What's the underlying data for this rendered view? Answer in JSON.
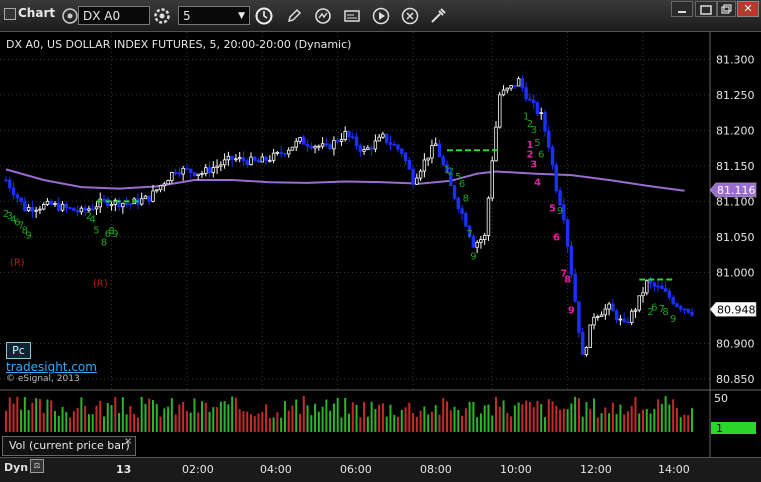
{
  "toolbar": {
    "title": "Chart",
    "symbol": "DX A0",
    "interval": "5",
    "icons": [
      "gear-icon",
      "clock-icon",
      "pencil-icon",
      "cycle-icon",
      "gallery-icon",
      "play-icon",
      "settings-icon",
      "tools-icon"
    ]
  },
  "chart_data": {
    "type": "candlestick",
    "title": "DX A0, US DOLLAR INDEX FUTURES, 5, 20:00-20:00 (Dynamic)",
    "y_ticks": [
      "81.300",
      "81.250",
      "81.200",
      "81.150",
      "81.100",
      "81.050",
      "81.000",
      "80.900",
      "80.850"
    ],
    "y_range": [
      80.84,
      81.33
    ],
    "x_ticks": [
      "13",
      "02:00",
      "04:00",
      "06:00",
      "08:00",
      "10:00",
      "12:00",
      "14:00"
    ],
    "last_price": "80.948",
    "ma_value": "81.116",
    "moving_average": [
      {
        "bar": 0,
        "v": 81.145
      },
      {
        "bar": 10,
        "v": 81.13
      },
      {
        "bar": 20,
        "v": 81.12
      },
      {
        "bar": 30,
        "v": 81.118
      },
      {
        "bar": 40,
        "v": 81.121
      },
      {
        "bar": 50,
        "v": 81.13
      },
      {
        "bar": 60,
        "v": 81.13
      },
      {
        "bar": 70,
        "v": 81.127
      },
      {
        "bar": 80,
        "v": 81.126
      },
      {
        "bar": 90,
        "v": 81.128
      },
      {
        "bar": 100,
        "v": 81.127
      },
      {
        "bar": 110,
        "v": 81.125
      },
      {
        "bar": 118,
        "v": 81.129
      },
      {
        "bar": 125,
        "v": 81.139
      },
      {
        "bar": 130,
        "v": 81.142
      },
      {
        "bar": 140,
        "v": 81.139
      },
      {
        "bar": 150,
        "v": 81.137
      },
      {
        "bar": 160,
        "v": 81.13
      },
      {
        "bar": 170,
        "v": 81.122
      },
      {
        "bar": 180,
        "v": 81.115
      }
    ],
    "price_path": [
      {
        "bar": 0,
        "v": 81.13
      },
      {
        "bar": 5,
        "v": 81.09
      },
      {
        "bar": 12,
        "v": 81.095
      },
      {
        "bar": 20,
        "v": 81.085
      },
      {
        "bar": 26,
        "v": 81.1
      },
      {
        "bar": 33,
        "v": 81.097
      },
      {
        "bar": 38,
        "v": 81.105
      },
      {
        "bar": 45,
        "v": 81.145
      },
      {
        "bar": 52,
        "v": 81.14
      },
      {
        "bar": 60,
        "v": 81.16
      },
      {
        "bar": 67,
        "v": 81.155
      },
      {
        "bar": 72,
        "v": 81.165
      },
      {
        "bar": 78,
        "v": 81.185
      },
      {
        "bar": 85,
        "v": 81.175
      },
      {
        "bar": 90,
        "v": 81.195
      },
      {
        "bar": 95,
        "v": 81.17
      },
      {
        "bar": 100,
        "v": 81.19
      },
      {
        "bar": 105,
        "v": 81.17
      },
      {
        "bar": 108,
        "v": 81.13
      },
      {
        "bar": 112,
        "v": 81.165
      },
      {
        "bar": 114,
        "v": 81.18
      },
      {
        "bar": 118,
        "v": 81.12
      },
      {
        "bar": 122,
        "v": 81.07
      },
      {
        "bar": 124,
        "v": 81.04
      },
      {
        "bar": 127,
        "v": 81.05
      },
      {
        "bar": 129,
        "v": 81.16
      },
      {
        "bar": 131,
        "v": 81.25
      },
      {
        "bar": 134,
        "v": 81.26
      },
      {
        "bar": 136,
        "v": 81.27
      },
      {
        "bar": 139,
        "v": 81.24
      },
      {
        "bar": 142,
        "v": 81.22
      },
      {
        "bar": 144,
        "v": 81.18
      },
      {
        "bar": 146,
        "v": 81.12
      },
      {
        "bar": 148,
        "v": 81.08
      },
      {
        "bar": 150,
        "v": 81.0
      },
      {
        "bar": 152,
        "v": 80.92
      },
      {
        "bar": 153,
        "v": 80.88
      },
      {
        "bar": 156,
        "v": 80.94
      },
      {
        "bar": 160,
        "v": 80.95
      },
      {
        "bar": 164,
        "v": 80.925
      },
      {
        "bar": 167,
        "v": 80.95
      },
      {
        "bar": 170,
        "v": 80.985
      },
      {
        "bar": 174,
        "v": 80.975
      },
      {
        "bar": 178,
        "v": 80.955
      },
      {
        "bar": 182,
        "v": 80.945
      }
    ],
    "bars_count": 183,
    "level_lines": [
      {
        "from": 24,
        "to": 36,
        "v": 81.1,
        "color": "#2fd42f"
      },
      {
        "from": 117,
        "to": 131,
        "v": 81.172,
        "color": "#2fd42f"
      },
      {
        "from": 168,
        "to": 177,
        "v": 80.99,
        "color": "#2fd42f"
      }
    ],
    "markers": [
      {
        "bar": 0,
        "v": 81.078,
        "t": "2",
        "c": "#1fa31f"
      },
      {
        "bar": 1,
        "v": 81.075,
        "t": "3",
        "c": "#1fa31f"
      },
      {
        "bar": 2,
        "v": 81.07,
        "t": "4",
        "c": "#1fa31f"
      },
      {
        "bar": 3,
        "v": 81.066,
        "t": "6",
        "c": "#1fa31f"
      },
      {
        "bar": 4,
        "v": 81.062,
        "t": "7",
        "c": "#1fa31f"
      },
      {
        "bar": 5,
        "v": 81.055,
        "t": "8",
        "c": "#1fa31f"
      },
      {
        "bar": 6,
        "v": 81.048,
        "t": "9",
        "c": "#1fa31f"
      },
      {
        "bar": 22,
        "v": 81.075,
        "t": "2",
        "c": "#1fa31f"
      },
      {
        "bar": 23,
        "v": 81.07,
        "t": "4",
        "c": "#1fa31f"
      },
      {
        "bar": 24,
        "v": 81.055,
        "t": "5",
        "c": "#1fa31f"
      },
      {
        "bar": 27,
        "v": 81.05,
        "t": "6",
        "c": "#1fa31f"
      },
      {
        "bar": 28,
        "v": 81.054,
        "t": "8",
        "c": "#1fa31f"
      },
      {
        "bar": 26,
        "v": 81.038,
        "t": "8",
        "c": "#1fa31f"
      },
      {
        "bar": 29,
        "v": 81.05,
        "t": "9",
        "c": "#1fa31f"
      },
      {
        "bar": 117,
        "v": 81.14,
        "t": "1",
        "c": "#1fa31f"
      },
      {
        "bar": 118,
        "v": 81.138,
        "t": "2",
        "c": "#1fa31f"
      },
      {
        "bar": 120,
        "v": 81.13,
        "t": "5",
        "c": "#1fa31f"
      },
      {
        "bar": 121,
        "v": 81.12,
        "t": "6",
        "c": "#1fa31f"
      },
      {
        "bar": 122,
        "v": 81.1,
        "t": "8",
        "c": "#1fa31f"
      },
      {
        "bar": 123,
        "v": 81.05,
        "t": "7",
        "c": "#1fa31f"
      },
      {
        "bar": 124,
        "v": 81.018,
        "t": "9",
        "c": "#1fa31f"
      },
      {
        "bar": 138,
        "v": 81.215,
        "t": "1",
        "c": "#1fa31f"
      },
      {
        "bar": 139,
        "v": 81.205,
        "t": "2",
        "c": "#1fa31f"
      },
      {
        "bar": 140,
        "v": 81.196,
        "t": "3",
        "c": "#1fa31f"
      },
      {
        "bar": 141,
        "v": 81.178,
        "t": "5",
        "c": "#1fa31f"
      },
      {
        "bar": 142,
        "v": 81.162,
        "t": "6",
        "c": "#1fa31f"
      },
      {
        "bar": 139,
        "v": 81.175,
        "t": "1",
        "c": "#e020a0",
        "bold": true
      },
      {
        "bar": 139,
        "v": 81.162,
        "t": "2",
        "c": "#e020a0",
        "bold": true
      },
      {
        "bar": 140,
        "v": 81.148,
        "t": "3",
        "c": "#e020a0",
        "bold": true
      },
      {
        "bar": 141,
        "v": 81.122,
        "t": "4",
        "c": "#e020a0",
        "bold": true
      },
      {
        "bar": 145,
        "v": 81.086,
        "t": "5",
        "c": "#e020a0",
        "bold": true
      },
      {
        "bar": 147,
        "v": 81.082,
        "t": "9",
        "c": "#1fa31f"
      },
      {
        "bar": 146,
        "v": 81.045,
        "t": "6",
        "c": "#e020a0",
        "bold": true
      },
      {
        "bar": 148,
        "v": 80.994,
        "t": "7",
        "c": "#e020a0",
        "bold": true
      },
      {
        "bar": 149,
        "v": 80.986,
        "t": "8",
        "c": "#e020a0",
        "bold": true
      },
      {
        "bar": 150,
        "v": 80.942,
        "t": "9",
        "c": "#e020a0",
        "bold": true
      },
      {
        "bar": 171,
        "v": 80.94,
        "t": "2",
        "c": "#1fa31f"
      },
      {
        "bar": 172,
        "v": 80.946,
        "t": "6",
        "c": "#1fa31f"
      },
      {
        "bar": 174,
        "v": 80.944,
        "t": "7",
        "c": "#1fa31f"
      },
      {
        "bar": 175,
        "v": 80.94,
        "t": "8",
        "c": "#1fa31f"
      },
      {
        "bar": 177,
        "v": 80.93,
        "t": "9",
        "c": "#1fa31f"
      }
    ],
    "r_labels": [
      {
        "bar": 3,
        "v": 81.01,
        "t": "(R)"
      },
      {
        "bar": 25,
        "v": 80.98,
        "t": "(R)"
      }
    ],
    "colors": {
      "up_candle": "#ffffff",
      "down_candle": "#1a30ff",
      "moving_average": "#9a6bd0",
      "volume_up": "#2bb52b",
      "volume_down": "#c62a2a",
      "grid": "#3a3a3a"
    },
    "volume_ticks": [
      "50",
      "1"
    ]
  },
  "footer": {
    "pc_label": "Pc",
    "site_link": "tradesight.com",
    "copyright": "© eSignal, 2013",
    "vol_label": "Vol (current price bar)",
    "vol_close": "×",
    "dyn_label": "Dyn"
  }
}
